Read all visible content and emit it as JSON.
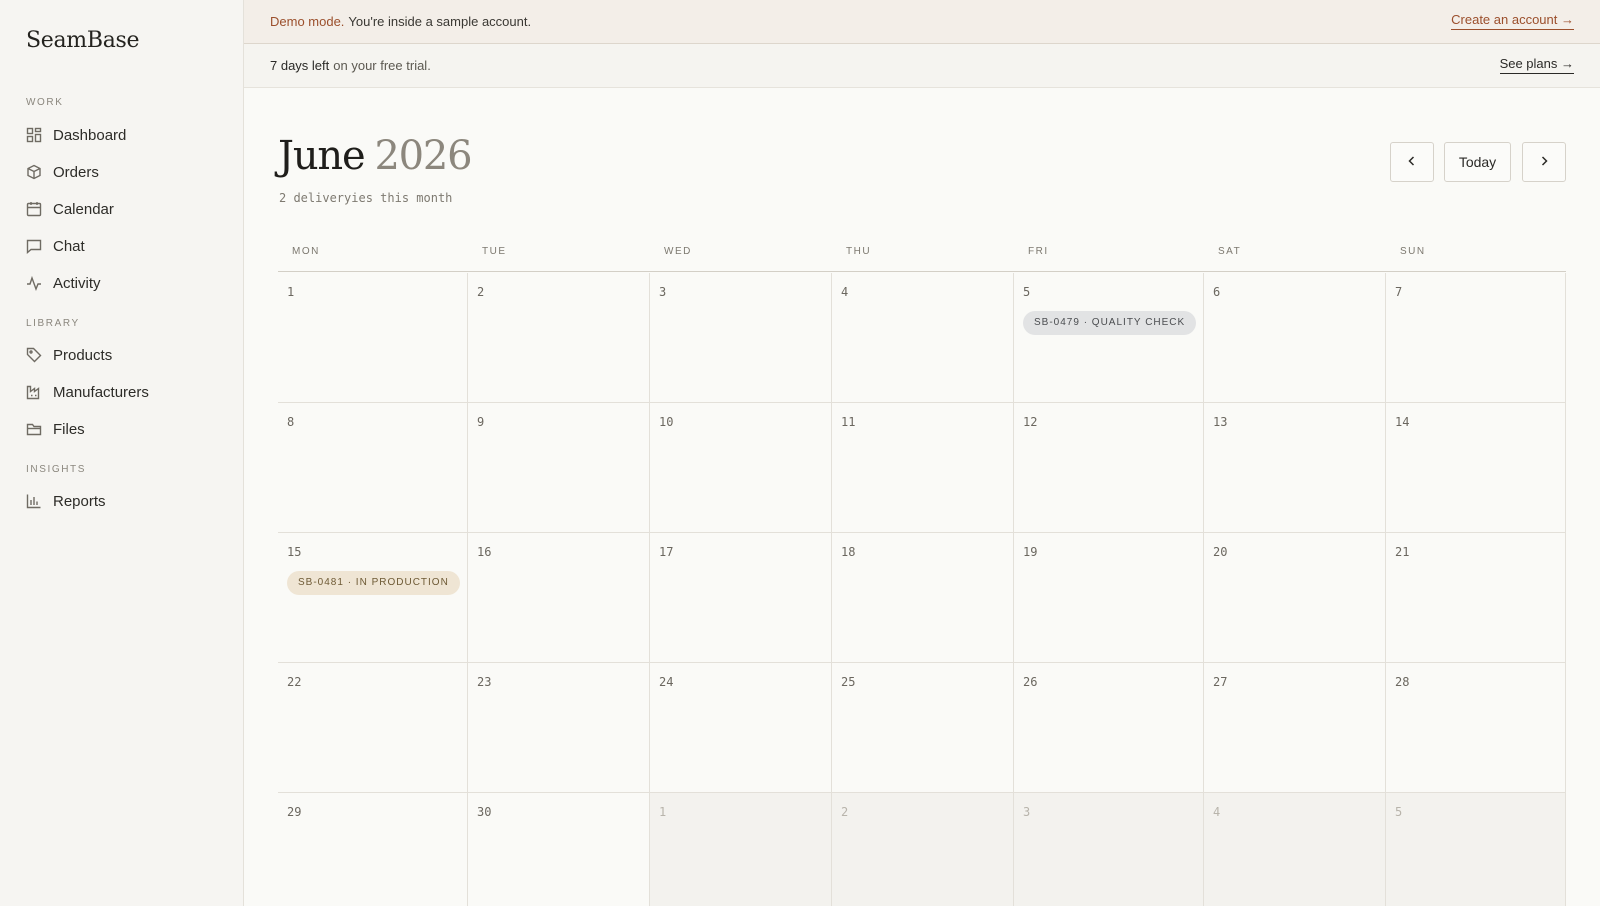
{
  "app": {
    "name": "SeamBase"
  },
  "sidebar": {
    "sections": [
      {
        "label": "WORK"
      },
      {
        "label": "LIBRARY"
      },
      {
        "label": "INSIGHTS"
      }
    ],
    "items": [
      {
        "label": "Dashboard",
        "icon": "grid-icon"
      },
      {
        "label": "Orders",
        "icon": "box-icon"
      },
      {
        "label": "Calendar",
        "icon": "calendar-icon"
      },
      {
        "label": "Chat",
        "icon": "chat-icon"
      },
      {
        "label": "Activity",
        "icon": "activity-icon"
      },
      {
        "label": "Products",
        "icon": "tag-icon"
      },
      {
        "label": "Manufacturers",
        "icon": "factory-icon"
      },
      {
        "label": "Files",
        "icon": "folder-icon"
      },
      {
        "label": "Reports",
        "icon": "bar-chart-icon"
      }
    ]
  },
  "banners": {
    "demo": {
      "strong": "Demo mode.",
      "text": "You're inside a sample account.",
      "link": "Create an account →"
    },
    "trial": {
      "strong": "7 days left",
      "text": "on your free trial.",
      "link": "See plans →"
    }
  },
  "header": {
    "month": "June",
    "year": "2026",
    "subtitle": "2 deliveryies this month",
    "today_label": "Today"
  },
  "calendar": {
    "weekdays": [
      "MON",
      "TUE",
      "WED",
      "THU",
      "FRI",
      "SAT",
      "SUN"
    ],
    "days": [
      "1",
      "2",
      "3",
      "4",
      "5",
      "6",
      "7",
      "8",
      "9",
      "10",
      "11",
      "12",
      "13",
      "14",
      "15",
      "16",
      "17",
      "18",
      "19",
      "20",
      "21",
      "22",
      "23",
      "24",
      "25",
      "26",
      "27",
      "28",
      "29",
      "30",
      "1",
      "2",
      "3",
      "4",
      "5"
    ],
    "events": [
      {
        "label": "SB-0479 · QUALITY CHECK",
        "status": "quality-check"
      },
      {
        "label": "SB-0481 · IN PRODUCTION",
        "status": "in-production"
      }
    ]
  },
  "colors": {
    "accent": "#9b4f2c",
    "quality_check_bg": "#e2e3e4",
    "in_production_bg": "#efe5d4"
  }
}
